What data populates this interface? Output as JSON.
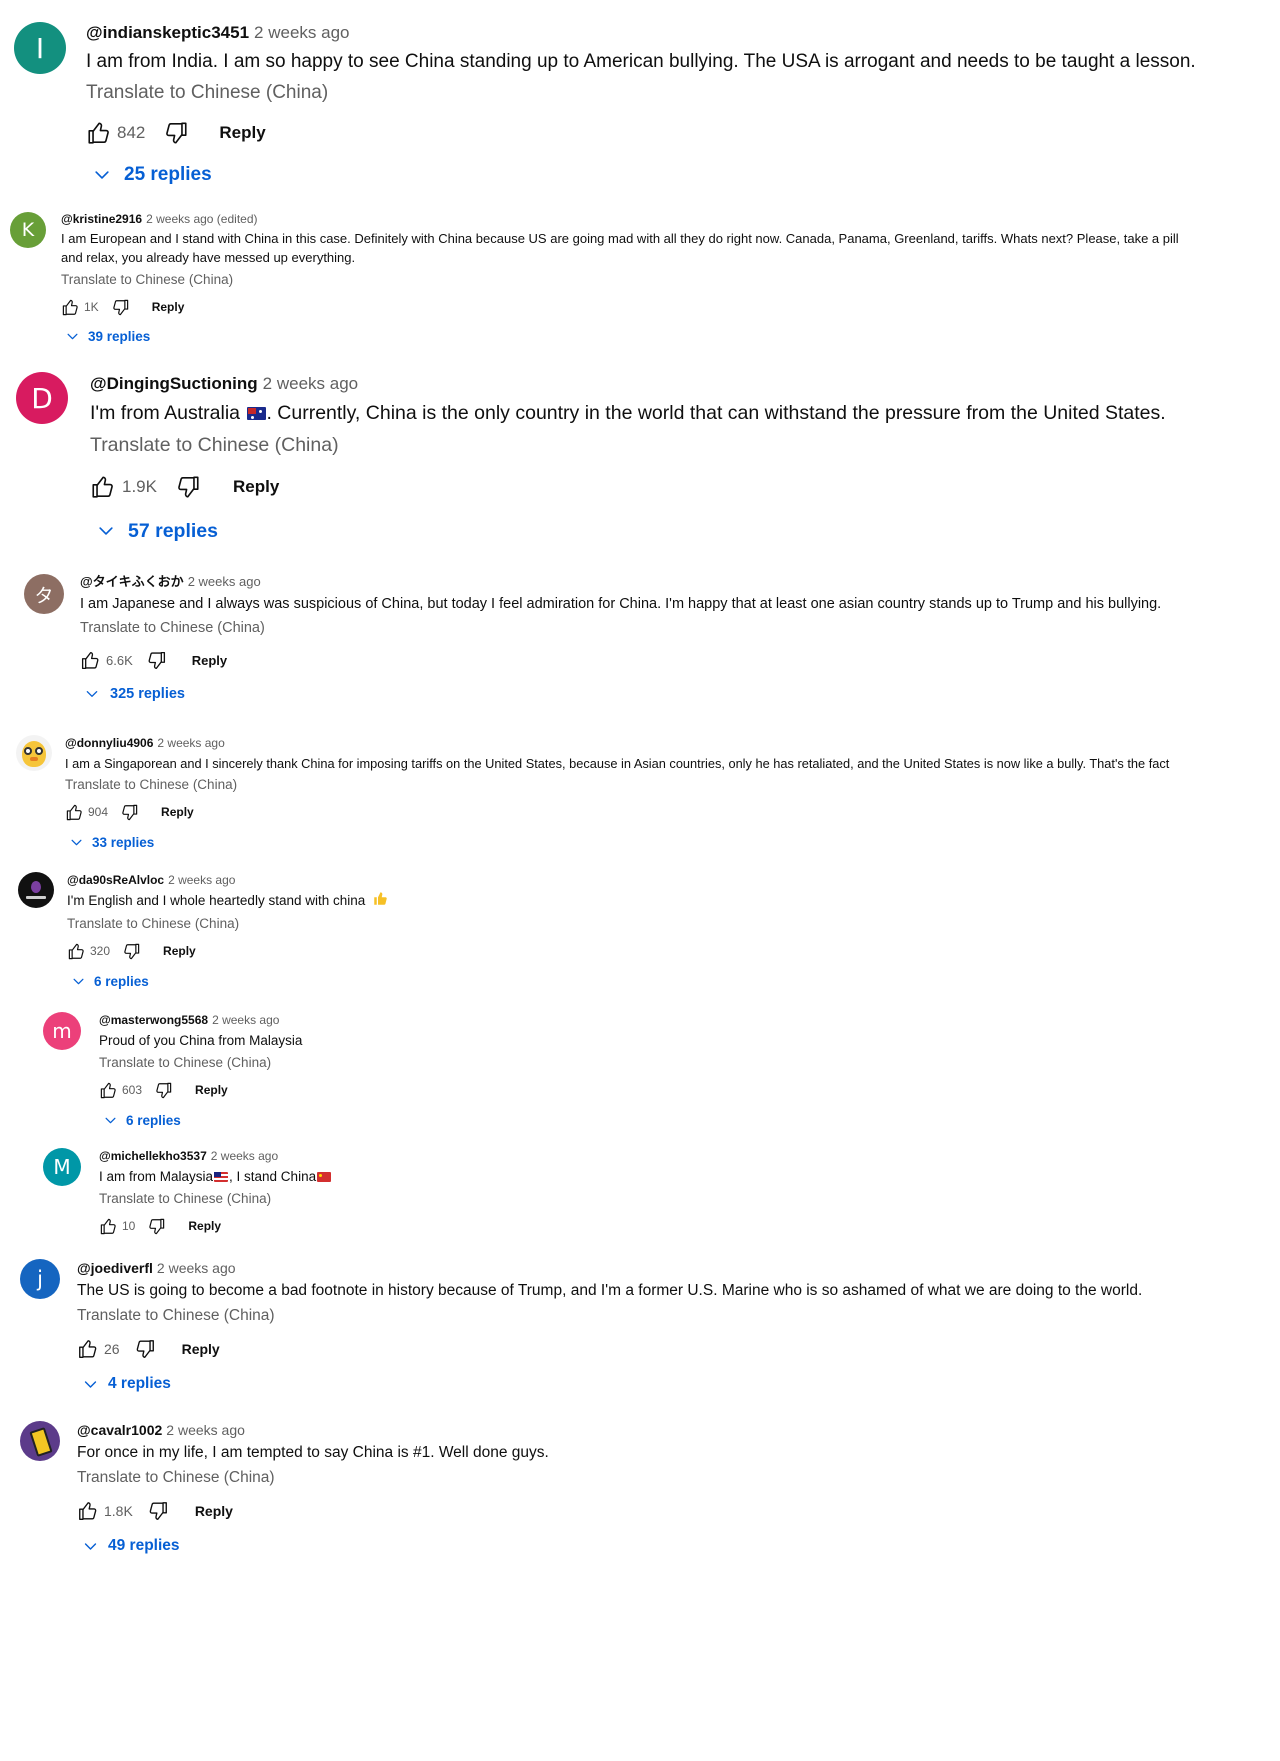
{
  "comments": [
    {
      "avatar_letter": "I",
      "avatar_color": "#13907f",
      "handle": "@indianskeptic3451",
      "time": "2 weeks ago",
      "text": "I am from India. I am so happy to see China standing up to American bullying. The USA is arrogant and needs to be taught a lesson.",
      "translate": "Translate to Chinese (China)",
      "likes": "842",
      "reply": "Reply",
      "replies": "25 replies"
    },
    {
      "avatar_letter": "K",
      "avatar_color": "#689f38",
      "handle": "@kristine2916",
      "time": "2 weeks ago (edited)",
      "text": "I am European and I stand with China in this case. Definitely with China because US are going mad with all they do right now. Canada, Panama, Greenland, tariffs. Whats next? Please, take a pill",
      "text2": "and relax, you already have messed up everything.",
      "translate": "Translate to Chinese (China)",
      "likes": "1K",
      "reply": "Reply",
      "replies": "39 replies"
    },
    {
      "avatar_letter": "D",
      "avatar_color": "#d81b60",
      "handle": "@DingingSuctioning",
      "time": "2 weeks ago",
      "text_a": "I'm from Australia",
      "text_b": ". Currently, China is the only country in the world that can withstand the pressure from the United States.",
      "translate": "Translate to Chinese (China)",
      "likes": "1.9K",
      "reply": "Reply",
      "replies": "57 replies"
    },
    {
      "avatar_letter": "タ",
      "avatar_color": "#8d6e63",
      "handle": "@タイキふくおか",
      "time": "2 weeks ago",
      "text": "I am Japanese and I always was suspicious of China, but today I feel admiration for China. I'm happy that at least one asian country stands up to Trump and his bullying.",
      "translate": "Translate to Chinese (China)",
      "likes": "6.6K",
      "reply": "Reply",
      "replies": "325 replies"
    },
    {
      "handle": "@donnyliu4906",
      "time": "2 weeks ago",
      "text": "I am a Singaporean and I sincerely thank China for imposing tariffs on the United States, because in Asian countries, only he has retaliated, and the United States is now like a bully. That's the fact",
      "translate": "Translate to Chinese (China)",
      "likes": "904",
      "reply": "Reply",
      "replies": "33 replies"
    },
    {
      "handle": "@da90sReAlvloc",
      "time": "2 weeks ago",
      "text": "I'm English and I whole heartedly stand with china",
      "translate": "Translate to Chinese (China)",
      "likes": "320",
      "reply": "Reply",
      "replies": "6 replies"
    },
    {
      "avatar_letter": "m",
      "avatar_color": "#ec407a",
      "handle": "@masterwong5568",
      "time": "2 weeks ago",
      "text": "Proud of you China from Malaysia",
      "translate": "Translate to Chinese (China)",
      "likes": "603",
      "reply": "Reply",
      "replies": "6 replies"
    },
    {
      "avatar_letter": "M",
      "avatar_color": "#0097a7",
      "handle": "@michellekho3537",
      "time": "2 weeks ago",
      "text_a": "I am from Malaysia",
      "text_b": ", I stand China",
      "translate": "Translate to Chinese (China)",
      "likes": "10",
      "reply": "Reply"
    },
    {
      "avatar_letter": "j",
      "avatar_color": "#1565c0",
      "handle": "@joediverfl",
      "time": "2 weeks ago",
      "text": "The US is going to become a  bad footnote in history because of Trump, and I'm a former U.S. Marine who is so ashamed of what we are doing to the world.",
      "translate": "Translate to Chinese (China)",
      "likes": "26",
      "reply": "Reply",
      "replies": "4 replies"
    },
    {
      "handle": "@cavalr1002",
      "time": "2 weeks ago",
      "text": "For once in my life, I am tempted to say China is #1. Well done guys.",
      "translate": "Translate to Chinese (China)",
      "likes": "1.8K",
      "reply": "Reply",
      "replies": "49 replies"
    }
  ],
  "icons": {
    "like": "thumbs-up-icon",
    "dislike": "thumbs-down-icon",
    "expand": "chevron-down-icon"
  },
  "colors": {
    "link_blue": "#065fd4",
    "secondary_text": "#606060"
  }
}
